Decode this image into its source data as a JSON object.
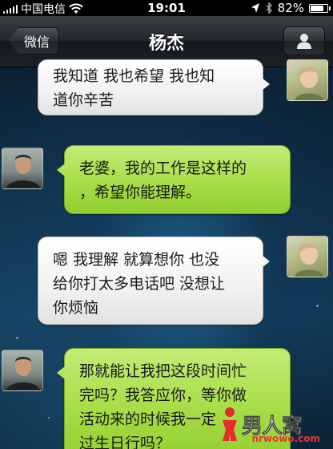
{
  "status_bar": {
    "carrier": "中国电信",
    "time": "19:01",
    "battery_percent_text": "82%",
    "battery_level": 0.82
  },
  "nav": {
    "back_label": "微信",
    "title": "杨杰",
    "profile_icon": "person-icon"
  },
  "messages": [
    {
      "sender": "female",
      "side": "right",
      "text": "我知道 我也希望 我也知\n道你辛苦"
    },
    {
      "sender": "male",
      "side": "left",
      "text": "老婆，我的工作是这样的\n，希望你能理解。"
    },
    {
      "sender": "female",
      "side": "right",
      "text": "嗯 我理解 就算想你 也没\n给你打太多电话吧 没想让\n你烦恼"
    },
    {
      "sender": "male",
      "side": "left",
      "text": "那就能让我把这段时间忙\n完吗？我答应你，等你做\n活动来的时候我一定\n过生日行吗？"
    }
  ],
  "watermark": {
    "logo": "男人窝",
    "url": "nrwowo.com"
  },
  "colors": {
    "incoming_bubble": "#a7dd47",
    "outgoing_bubble": "#f1f1f1",
    "nav_background": "#24282d"
  }
}
